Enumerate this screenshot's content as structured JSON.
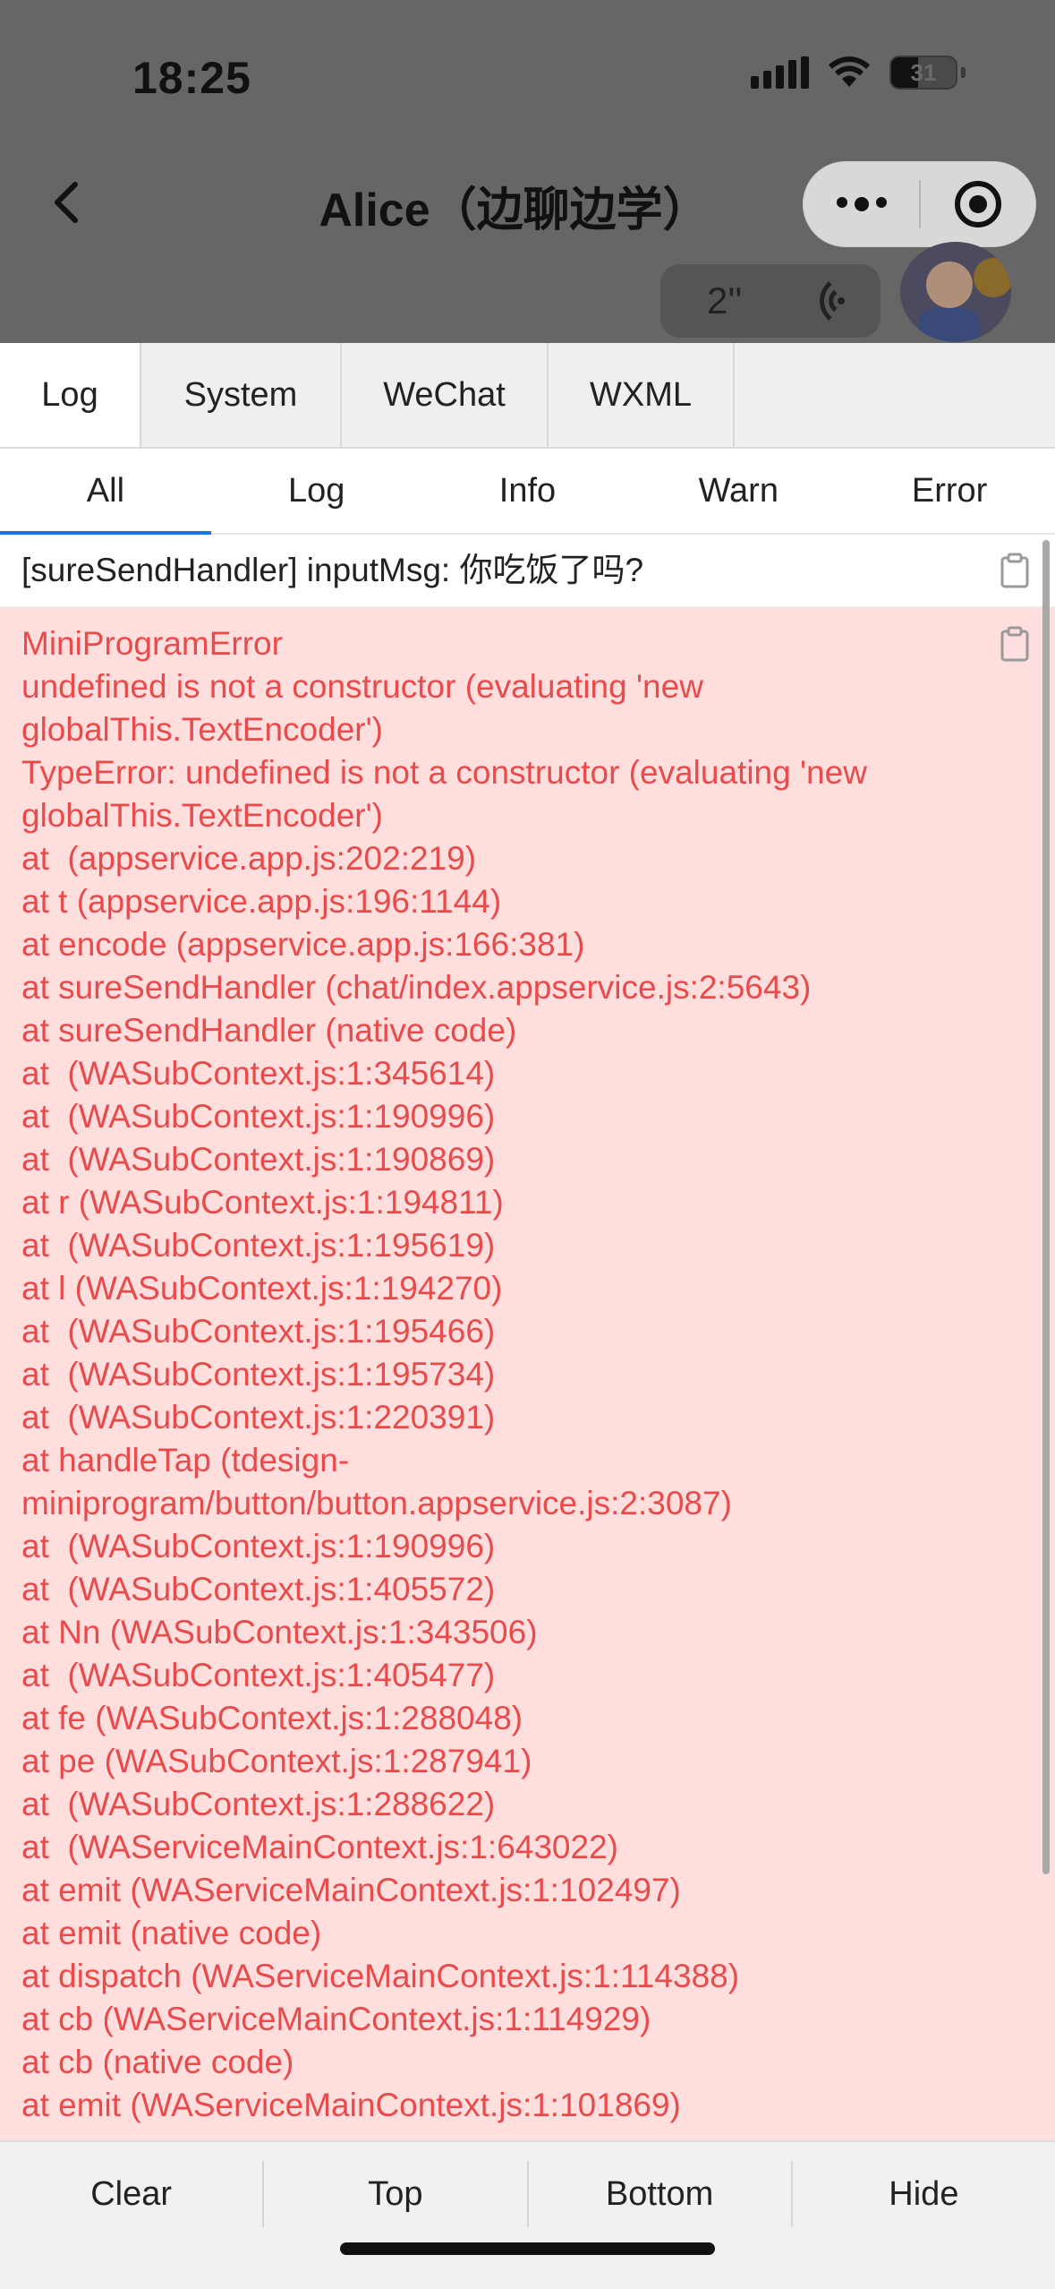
{
  "status_bar": {
    "time": "18:25",
    "battery": "31"
  },
  "nav": {
    "title": "Alice（边聊边学）"
  },
  "chat": {
    "voice_duration": "2''"
  },
  "main_tabs": [
    "Log",
    "System",
    "WeChat",
    "WXML"
  ],
  "sub_tabs": [
    "All",
    "Log",
    "Info",
    "Warn",
    "Error"
  ],
  "logs": {
    "entry1": "[sureSendHandler] inputMsg: 你吃饭了吗?",
    "error_lines": [
      "MiniProgramError",
      "undefined is not a constructor (evaluating 'new",
      "globalThis.TextEncoder')",
      "TypeError: undefined is not a constructor (evaluating 'new",
      "globalThis.TextEncoder')",
      "at  (appservice.app.js:202:219)",
      "at t (appservice.app.js:196:1144)",
      "at encode (appservice.app.js:166:381)",
      "at sureSendHandler (chat/index.appservice.js:2:5643)",
      "at sureSendHandler (native code)",
      "at  (WASubContext.js:1:345614)",
      "at  (WASubContext.js:1:190996)",
      "at  (WASubContext.js:1:190869)",
      "at r (WASubContext.js:1:194811)",
      "at  (WASubContext.js:1:195619)",
      "at l (WASubContext.js:1:194270)",
      "at  (WASubContext.js:1:195466)",
      "at  (WASubContext.js:1:195734)",
      "at  (WASubContext.js:1:220391)",
      "at handleTap (tdesign-",
      "miniprogram/button/button.appservice.js:2:3087)",
      "at  (WASubContext.js:1:190996)",
      "at  (WASubContext.js:1:405572)",
      "at Nn (WASubContext.js:1:343506)",
      "at  (WASubContext.js:1:405477)",
      "at fe (WASubContext.js:1:288048)",
      "at pe (WASubContext.js:1:287941)",
      "at  (WASubContext.js:1:288622)",
      "at  (WAServiceMainContext.js:1:643022)",
      "at emit (WAServiceMainContext.js:1:102497)",
      "at emit (native code)",
      "at dispatch (WAServiceMainContext.js:1:114388)",
      "at cb (WAServiceMainContext.js:1:114929)",
      "at cb (native code)",
      "at emit (WAServiceMainContext.js:1:101869)"
    ]
  },
  "bottom_buttons": [
    "Clear",
    "Top",
    "Bottom",
    "Hide"
  ],
  "colors": {
    "error_text": "#e84b4b",
    "error_bg": "#ffdede",
    "active_tab_underline": "#1a73e8"
  }
}
